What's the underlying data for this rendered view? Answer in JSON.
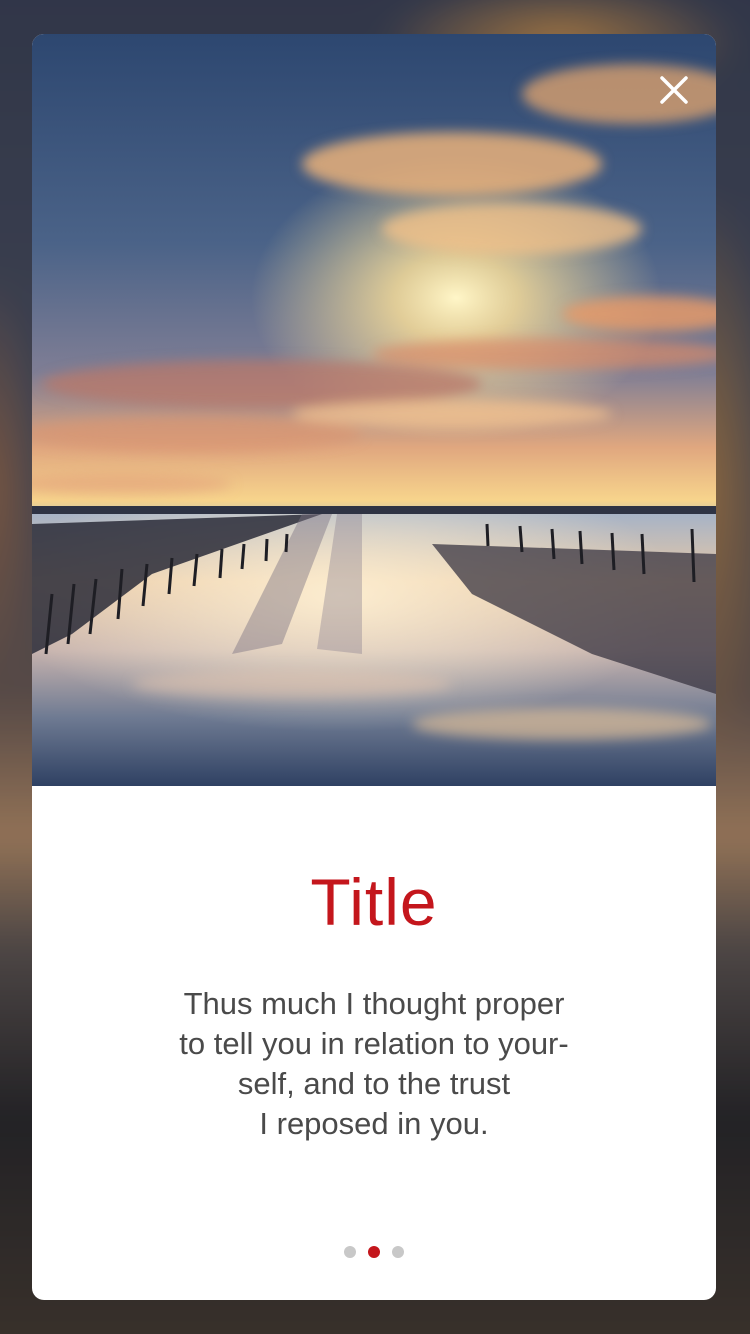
{
  "card": {
    "title": "Title",
    "body_lines": [
      "Thus much I thought proper",
      "to tell you in relation to your-",
      "self, and to the trust",
      "I reposed in you."
    ]
  },
  "icons": {
    "close": "close-icon"
  },
  "pager": {
    "total": 3,
    "active_index": 1
  },
  "colors": {
    "accent": "#c4161c",
    "dot_inactive": "#c8c8c8",
    "body_text": "#4a4a4a"
  }
}
